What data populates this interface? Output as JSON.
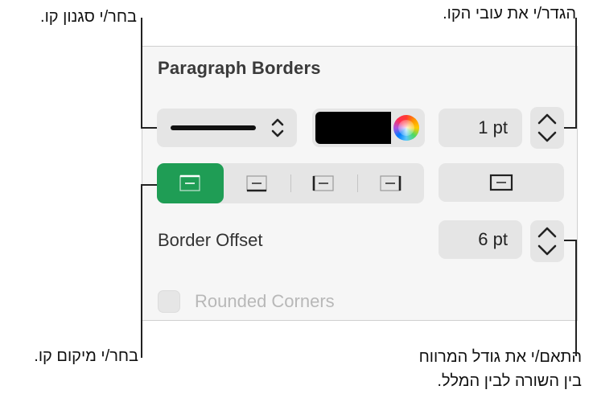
{
  "panel": {
    "title": "Paragraph Borders",
    "border_offset_label": "Border Offset",
    "rounded_corners_label": "Rounded Corners"
  },
  "line_style": {
    "value": "solid",
    "icon": "solid-line-icon"
  },
  "line_color": {
    "value": "#000000",
    "wheel_icon": "color-wheel-icon"
  },
  "line_width": {
    "value": "1 pt"
  },
  "border_offset": {
    "value": "6 pt"
  },
  "position_buttons": [
    {
      "name": "top-border",
      "selected": true
    },
    {
      "name": "bottom-border",
      "selected": false
    },
    {
      "name": "left-border",
      "selected": false
    },
    {
      "name": "right-border",
      "selected": false
    }
  ],
  "all_borders_button": {
    "name": "box-border"
  },
  "rounded_corners": {
    "checked": false,
    "enabled": false
  },
  "callouts": {
    "choose_line_style": "בחר/י סגנון קו.",
    "set_line_thickness": "הגדר/י את עובי הקו.",
    "choose_line_position": "בחר/י מיקום קו.",
    "adjust_spacing_line1": "התאם/י את גודל המרווח",
    "adjust_spacing_line2": "בין השורה לבין המלל."
  },
  "colors": {
    "accent_selected": "#1f9d55",
    "control_bg": "#e5e5e5",
    "panel_bg": "#f6f6f6"
  }
}
